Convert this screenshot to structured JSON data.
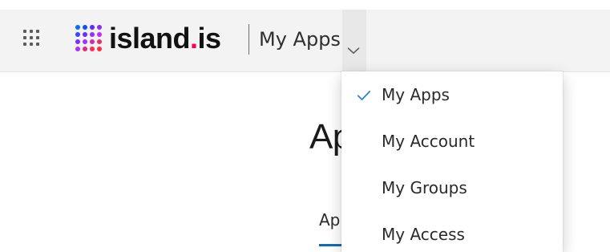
{
  "header": {
    "brand": {
      "name_main": "island",
      "name_dot": ".",
      "name_tld": "is"
    },
    "app_switcher_label": "My Apps",
    "icons": {
      "launcher": "waffle-grid-icon",
      "brand_mark": "dot-grid-logo-icon",
      "switcher_chevron": "chevron-down-icon",
      "selected_check": "checkmark-icon"
    }
  },
  "dropdown": {
    "items": [
      {
        "label": "My Apps",
        "selected": true
      },
      {
        "label": "My Account",
        "selected": false
      },
      {
        "label": "My Groups",
        "selected": false
      },
      {
        "label": "My Access",
        "selected": false
      }
    ]
  },
  "main": {
    "title_partial": "Ap",
    "tab_partial": "App"
  },
  "colors": {
    "topbar_bg": "#f3f3f3",
    "accent_blue": "#0f6cbd",
    "check_blue": "#2f80c8",
    "brand_dot_pink": "#ff0050"
  }
}
